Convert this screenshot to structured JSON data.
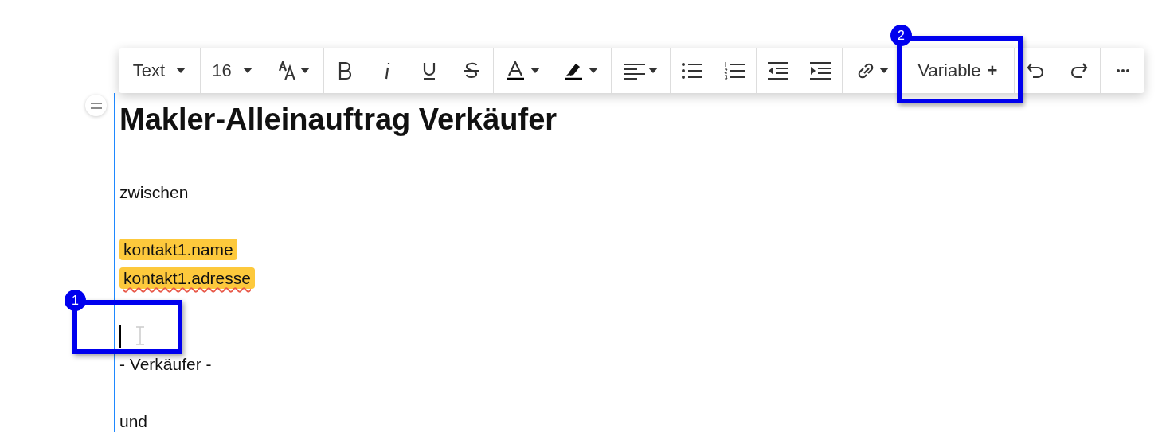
{
  "toolbar": {
    "block_type": "Text",
    "font_size": "16",
    "variable_label": "Variable",
    "variable_plus": "+"
  },
  "document": {
    "heading": "Makler-Alleinauftrag Verkäufer",
    "blocks": [
      {
        "kind": "text",
        "text": "zwischen"
      },
      {
        "kind": "blank"
      },
      {
        "kind": "variable",
        "text": "kontakt1.name",
        "misspelled": false
      },
      {
        "kind": "variable",
        "text": "kontakt1.adresse",
        "misspelled": true
      },
      {
        "kind": "blank"
      },
      {
        "kind": "caret"
      },
      {
        "kind": "text",
        "text": "- Verkäufer -"
      },
      {
        "kind": "blank"
      },
      {
        "kind": "text",
        "text": "und"
      }
    ]
  },
  "callouts": [
    {
      "number": "1"
    },
    {
      "number": "2"
    }
  ]
}
